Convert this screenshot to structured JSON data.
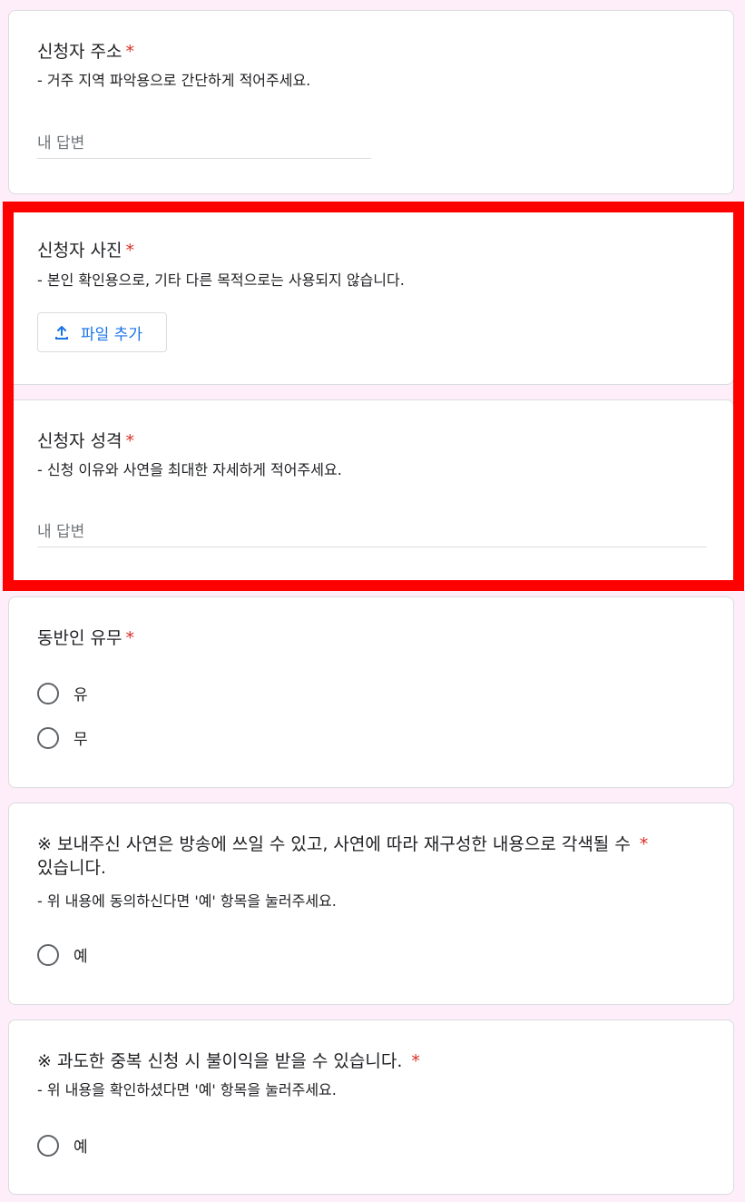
{
  "required_mark": "*",
  "address": {
    "title": "신청자 주소",
    "desc": "- 거주 지역 파악용으로 간단하게 적어주세요.",
    "placeholder": "내 답변"
  },
  "photo": {
    "title": "신청자 사진",
    "desc": "- 본인 확인용으로, 기타 다른 목적으로는 사용되지 않습니다.",
    "upload_label": "파일 추가",
    "upload_icon": "upload-icon"
  },
  "story": {
    "title": "신청자 성격",
    "desc": "- 신청 이유와 사연을 최대한 자세하게 적어주세요.",
    "placeholder": "내 답변"
  },
  "companion": {
    "title": "동반인 유무",
    "options": [
      "유",
      "무"
    ]
  },
  "consent": {
    "title_line1": "※ 보내주신 사연은 방송에 쓰일 수 있고, 사연에 따라 재구성한 내용으로 각색될 수",
    "title_line2": "있습니다.",
    "desc": "- 위 내용에 동의하신다면 '예' 항목을 눌러주세요.",
    "option": "예"
  },
  "duplicate": {
    "title": "※ 과도한 중복 신청 시 불이익을 받을 수 있습니다.",
    "desc": "- 위 내용을 확인하셨다면 '예' 항목을 눌러주세요.",
    "option": "예"
  },
  "colors": {
    "background": "#fdeef9",
    "required": "#d93025",
    "accent": "#1a73e8",
    "highlight": "#ff0000"
  }
}
